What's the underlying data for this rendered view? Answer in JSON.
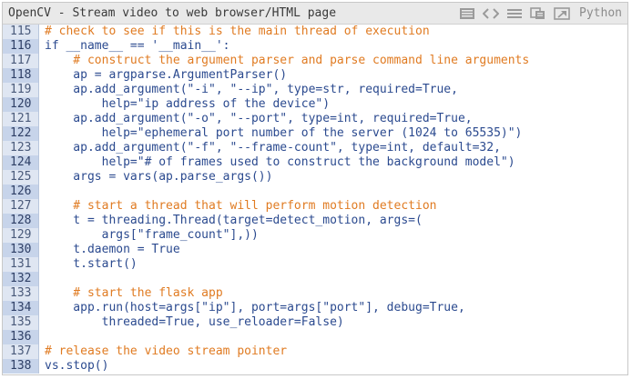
{
  "window": {
    "title": "OpenCV - Stream video to web browser/HTML page",
    "language": "Python",
    "toolbar_icons": [
      "view-source-icon",
      "code-brackets-icon",
      "wrap-lines-icon",
      "copy-icon",
      "open-new-window-icon"
    ]
  },
  "colors": {
    "comment": "#e07b22",
    "code": "#2b4a8f",
    "gutter_bg": "#dfe6f2",
    "gutter_highlight": "#c7d4ea"
  },
  "lines": [
    {
      "num": "115",
      "text": "# check to see if this is the main thread of execution",
      "type": "comment",
      "hl": false
    },
    {
      "num": "116",
      "text": "if __name__ == '__main__':",
      "type": "code",
      "hl": true
    },
    {
      "num": "117",
      "text": "    # construct the argument parser and parse command line arguments",
      "type": "comment",
      "hl": false
    },
    {
      "num": "118",
      "text": "    ap = argparse.ArgumentParser()",
      "type": "code",
      "hl": true
    },
    {
      "num": "119",
      "text": "    ap.add_argument(\"-i\", \"--ip\", type=str, required=True,",
      "type": "code",
      "hl": false
    },
    {
      "num": "120",
      "text": "        help=\"ip address of the device\")",
      "type": "code",
      "hl": true
    },
    {
      "num": "121",
      "text": "    ap.add_argument(\"-o\", \"--port\", type=int, required=True,",
      "type": "code",
      "hl": false
    },
    {
      "num": "122",
      "text": "        help=\"ephemeral port number of the server (1024 to 65535)\")",
      "type": "code",
      "hl": true
    },
    {
      "num": "123",
      "text": "    ap.add_argument(\"-f\", \"--frame-count\", type=int, default=32,",
      "type": "code",
      "hl": false
    },
    {
      "num": "124",
      "text": "        help=\"# of frames used to construct the background model\")",
      "type": "code",
      "hl": true
    },
    {
      "num": "125",
      "text": "    args = vars(ap.parse_args())",
      "type": "code",
      "hl": false
    },
    {
      "num": "126",
      "text": "",
      "type": "code",
      "hl": true
    },
    {
      "num": "127",
      "text": "    # start a thread that will perform motion detection",
      "type": "comment",
      "hl": false
    },
    {
      "num": "128",
      "text": "    t = threading.Thread(target=detect_motion, args=(",
      "type": "code",
      "hl": true
    },
    {
      "num": "129",
      "text": "        args[\"frame_count\"],))",
      "type": "code",
      "hl": false
    },
    {
      "num": "130",
      "text": "    t.daemon = True",
      "type": "code",
      "hl": true
    },
    {
      "num": "131",
      "text": "    t.start()",
      "type": "code",
      "hl": false
    },
    {
      "num": "132",
      "text": "",
      "type": "code",
      "hl": true
    },
    {
      "num": "133",
      "text": "    # start the flask app",
      "type": "comment",
      "hl": false
    },
    {
      "num": "134",
      "text": "    app.run(host=args[\"ip\"], port=args[\"port\"], debug=True,",
      "type": "code",
      "hl": true
    },
    {
      "num": "135",
      "text": "        threaded=True, use_reloader=False)",
      "type": "code",
      "hl": false
    },
    {
      "num": "136",
      "text": "",
      "type": "code",
      "hl": true
    },
    {
      "num": "137",
      "text": "# release the video stream pointer",
      "type": "comment",
      "hl": false
    },
    {
      "num": "138",
      "text": "vs.stop()",
      "type": "code",
      "hl": true
    }
  ]
}
